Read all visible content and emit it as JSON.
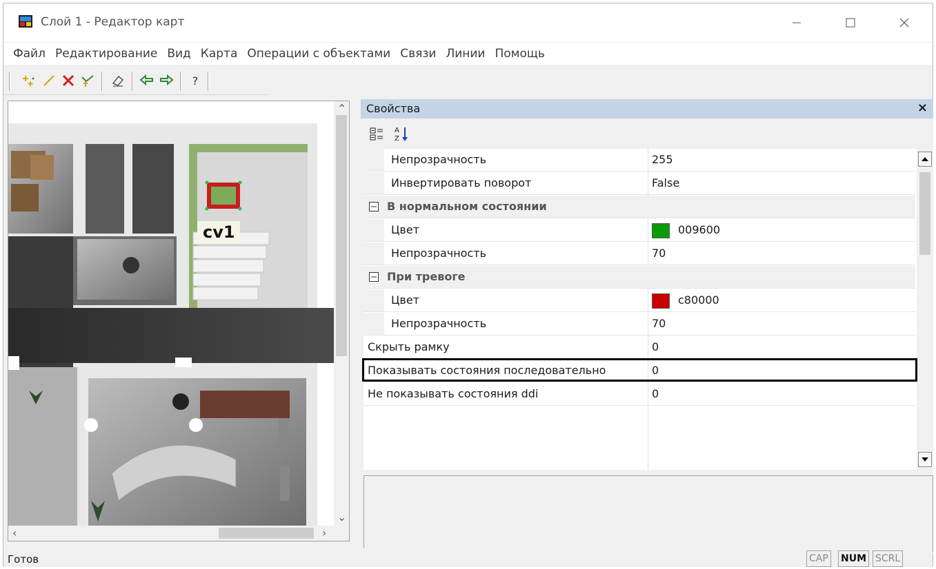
{
  "window": {
    "title": "Слой 1 - Редактор карт"
  },
  "menu": [
    "Файл",
    "Редактирование",
    "Вид",
    "Карта",
    "Операции с объектами",
    "Связи",
    "Линии",
    "Помощь"
  ],
  "toolbar": {
    "help_label": "?"
  },
  "map": {
    "label": "cv1"
  },
  "properties": {
    "title": "Свойства",
    "close": "×",
    "rows": [
      {
        "name": "Непрозрачность",
        "value": "255",
        "indent": true,
        "category": false
      },
      {
        "name": "Инвертировать поворот",
        "value": "False",
        "indent": true,
        "category": false
      },
      {
        "name": "В нормальном состоянии",
        "value": "",
        "indent": false,
        "category": true
      },
      {
        "name": "Цвет",
        "value": "009600",
        "indent": true,
        "category": false,
        "swatch": "#0a9b0a"
      },
      {
        "name": "Непрозрачность",
        "value": "70",
        "indent": true,
        "category": false
      },
      {
        "name": "При тревоге",
        "value": "",
        "indent": false,
        "category": true
      },
      {
        "name": "Цвет",
        "value": "c80000",
        "indent": true,
        "category": false,
        "swatch": "#c80000"
      },
      {
        "name": "Непрозрачность",
        "value": "70",
        "indent": true,
        "category": false
      },
      {
        "name": "Скрыть рамку",
        "value": "0",
        "indent": false,
        "category": false
      },
      {
        "name": "Показывать состояния последовательно",
        "value": "0",
        "indent": false,
        "category": false
      },
      {
        "name": "Не показывать состояния ddi",
        "value": "0",
        "indent": false,
        "category": false
      }
    ]
  },
  "status": {
    "text": "Готов",
    "indicators": [
      {
        "label": "CAP",
        "active": false
      },
      {
        "label": "NUM",
        "active": true
      },
      {
        "label": "SCRL",
        "active": false
      }
    ]
  },
  "colors": {
    "header": "#c4d3e5",
    "green": "#0a9b0a",
    "red": "#c80000"
  }
}
